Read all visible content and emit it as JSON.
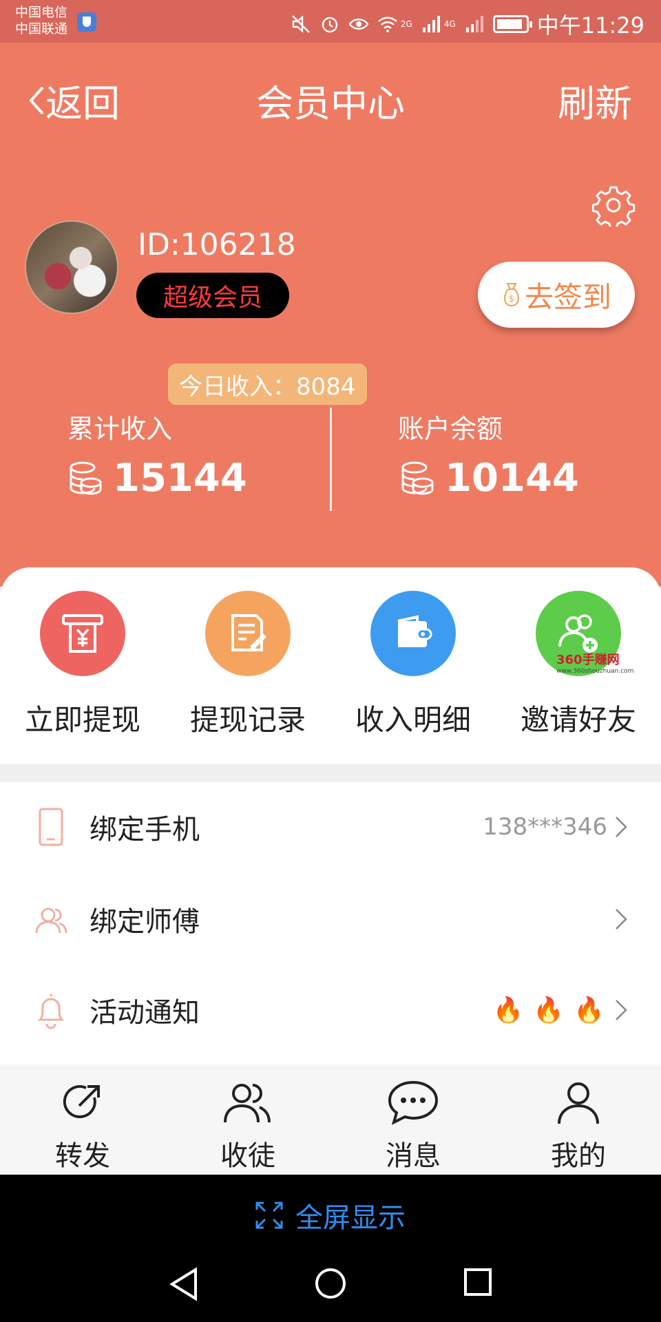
{
  "status_bar": {
    "carrier_1": "中国电信",
    "carrier_2": "中国联通",
    "network_1": "2G",
    "network_2": "4G",
    "time": "中午11:29",
    "icons": [
      "security-shield-icon",
      "mute-icon",
      "alarm-icon",
      "eye-comfort-icon",
      "wifi-icon",
      "signal-icon",
      "battery-icon"
    ]
  },
  "header": {
    "back_label": "返回",
    "title": "会员中心",
    "refresh_label": "刷新"
  },
  "profile": {
    "id_text": "ID:106218",
    "member_level": "超级会员",
    "checkin_label": "去签到"
  },
  "earnings": {
    "today_label": "今日收入：8084",
    "total_label": "累计收入",
    "total_value": "15144",
    "balance_label": "账户余额",
    "balance_value": "10144"
  },
  "actions": [
    {
      "label": "立即提现",
      "icon": "atm-withdraw-icon",
      "color": "#ee6461"
    },
    {
      "label": "提现记录",
      "icon": "record-edit-icon",
      "color": "#f5a45f"
    },
    {
      "label": "收入明细",
      "icon": "wallet-icon",
      "color": "#3d9cf0"
    },
    {
      "label": "邀请好友",
      "icon": "invite-friend-icon",
      "color": "#5ccc4a"
    }
  ],
  "watermark": {
    "main": "360手赚网",
    "sub": "www.360shouzhuan.com"
  },
  "settings": [
    {
      "label": "绑定手机",
      "value": "138***346",
      "icon": "phone-icon"
    },
    {
      "label": "绑定师傅",
      "value": "",
      "icon": "users-icon"
    },
    {
      "label": "活动通知",
      "value": "",
      "icon": "bell-icon",
      "flames": [
        "🔥",
        "🔥",
        "🔥"
      ]
    }
  ],
  "tabs": [
    {
      "label": "转发",
      "icon": "share-icon"
    },
    {
      "label": "收徒",
      "icon": "recruit-icon"
    },
    {
      "label": "消息",
      "icon": "message-icon"
    },
    {
      "label": "我的",
      "icon": "profile-icon"
    }
  ],
  "system": {
    "fullscreen_label": "全屏显示"
  },
  "colors": {
    "primary": "#ef7a62",
    "status_bar": "#d9665a",
    "today_badge": "#f4b678",
    "fullscreen_text": "#2f8df0"
  }
}
